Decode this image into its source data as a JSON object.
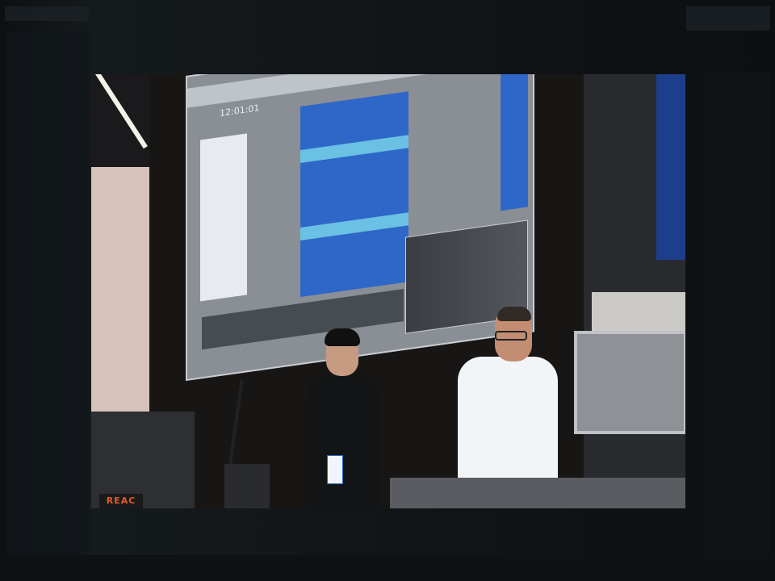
{
  "photo": {
    "logo_text": "REAC",
    "daw_timecode": "12:01:01"
  },
  "colors": {
    "waveform_blue": "#2f67c8",
    "waveform_highlight": "#79d8ea",
    "projection_gray": "#8a8e95",
    "logo_accent": "#e35b29"
  }
}
